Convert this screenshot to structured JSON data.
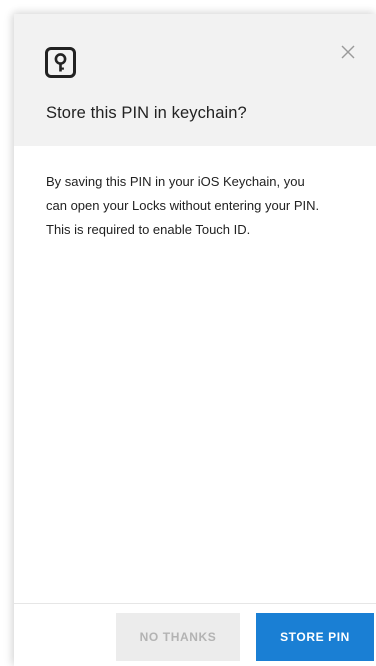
{
  "dialog": {
    "title": "Store this PIN in keychain?",
    "message_lines": [
      "By saving this PIN in your iOS Keychain, you",
      "can open your Locks without entering your PIN.",
      "This is required to enable Touch ID."
    ],
    "header_icon": "key-icon",
    "close_icon": "close-icon",
    "buttons": {
      "secondary_label": "NO THANKS",
      "primary_label": "STORE PIN"
    }
  },
  "colors": {
    "header_background": "#f2f2f2",
    "primary_button": "#1a7fd4",
    "secondary_button": "#ececec",
    "secondary_button_text": "#b3b3b3",
    "text": "#222222"
  }
}
